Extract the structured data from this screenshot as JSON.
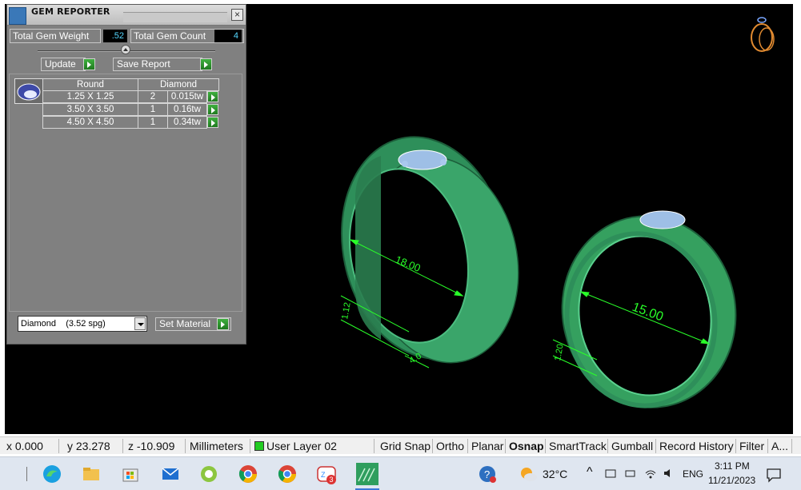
{
  "panel": {
    "title": "GEM REPORTER",
    "close_glyph": "×",
    "total_weight_label": "Total Gem Weight",
    "total_weight_value": ".52",
    "total_count_label": "Total Gem Count",
    "total_count_value": "4",
    "update_label": "Update",
    "save_report_label": "Save Report",
    "table": {
      "headers": [
        "Round",
        "Diamond"
      ],
      "rows": [
        {
          "size": "1.25 X 1.25",
          "count": "2",
          "weight": "0.015tw"
        },
        {
          "size": "3.50 X 3.50",
          "count": "1",
          "weight": "0.16tw"
        },
        {
          "size": "4.50 X 4.50",
          "count": "1",
          "weight": "0.34tw"
        }
      ]
    },
    "material_select": "Diamond    (3.52 spg)",
    "set_material_label": "Set Material"
  },
  "viewport": {
    "dimensions": [
      "18.00",
      "15.00",
      "4.0",
      "1.12",
      "1.20"
    ],
    "ring_color": "#2e8f5a",
    "wire_color": "#29ff29",
    "background": "#000000"
  },
  "statusbar": {
    "x": "x 0.000",
    "y": "y 23.278",
    "z": "z -10.909",
    "units": "Millimeters",
    "layer": "User Layer 02",
    "toggles": [
      "Grid Snap",
      "Ortho",
      "Planar",
      "Osnap",
      "SmartTrack",
      "Gumball",
      "Record History",
      "Filter",
      "A..."
    ]
  },
  "taskbar": {
    "apps": [
      "edge-icon",
      "file-explorer-icon",
      "store-icon",
      "mail-icon",
      "gem-app-icon",
      "chrome-icon",
      "chrome-icon",
      "zoom-icon",
      "rhino-icon"
    ],
    "zoom_badge": "3",
    "weather": "32°C",
    "language": "ENG",
    "time": "3:11 PM",
    "date": "11/21/2023"
  }
}
